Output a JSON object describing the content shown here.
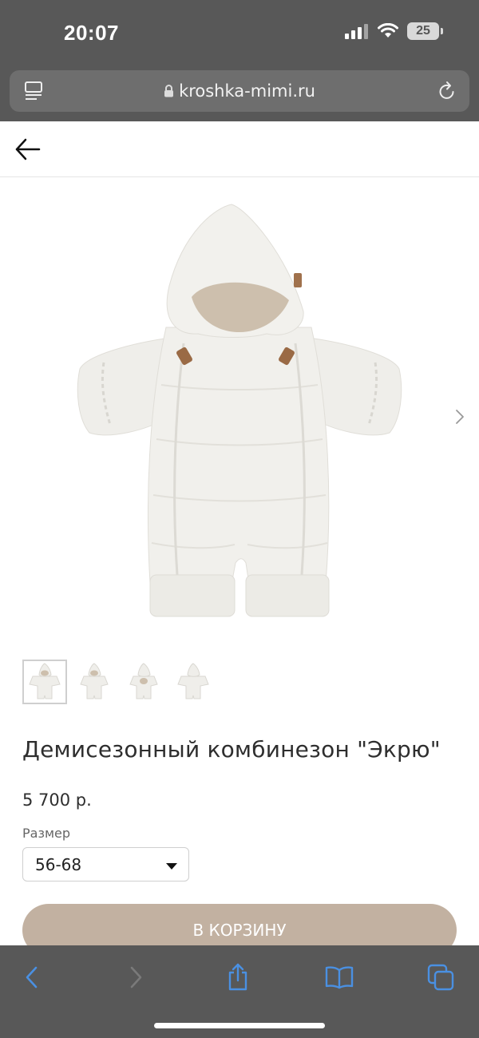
{
  "status_bar": {
    "time": "20:07",
    "battery_level": "25",
    "icons": [
      "signal-icon",
      "wifi-icon",
      "battery-icon"
    ]
  },
  "browser": {
    "url": "kroshka-mimi.ru",
    "icons": [
      "reader-mode-icon",
      "lock-icon",
      "reload-icon"
    ]
  },
  "page": {
    "back_icon": "arrow-left-icon",
    "gallery": {
      "next_icon": "chevron-right-icon",
      "thumbnail_count": 4,
      "active_thumbnail": 1
    },
    "product": {
      "title": "Демисезонный комбинезон \"Экрю\"",
      "price": "5 700 р.",
      "size_label": "Размер",
      "size_value": "56-68",
      "add_to_cart": "В КОРЗИНУ"
    }
  },
  "toolbar": {
    "items": [
      "back-icon",
      "forward-icon",
      "share-icon",
      "bookmarks-icon",
      "tabs-icon"
    ]
  },
  "colors": {
    "browser_chrome": "#585858",
    "url_field": "#6e6e6e",
    "accent_button": "#c2b1a1",
    "toolbar_active": "#4a90e2"
  }
}
